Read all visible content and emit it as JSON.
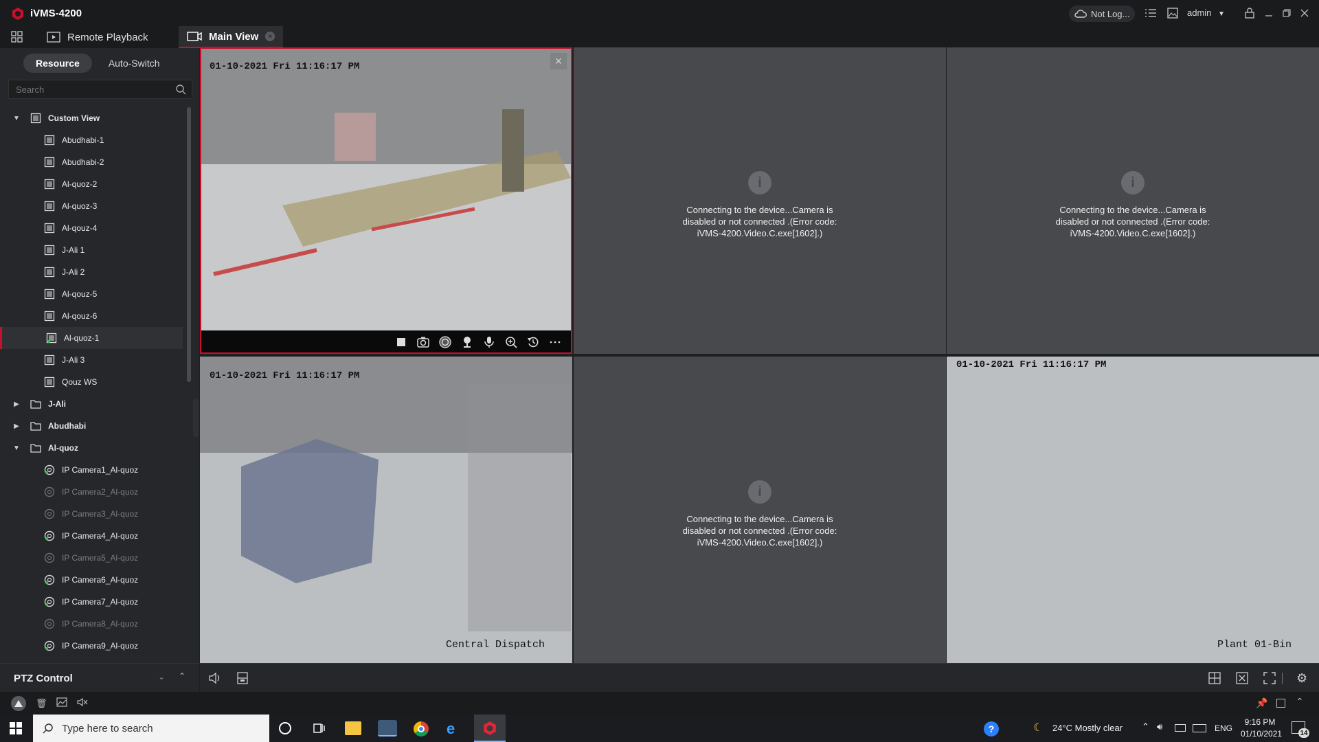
{
  "app": {
    "title": "iVMS-4200"
  },
  "titlebar": {
    "login_status": "Not Log...",
    "user": "admin"
  },
  "tabs": [
    {
      "label": "Remote Playback"
    },
    {
      "label": "Main View"
    }
  ],
  "sidebar": {
    "segments": [
      "Resource",
      "Auto-Switch"
    ],
    "search_placeholder": "Search",
    "tree": [
      {
        "label": "Custom View",
        "level": 0,
        "kind": "view-group",
        "expanded": true,
        "bold": true
      },
      {
        "label": "Abudhabi-1",
        "level": 1,
        "kind": "view"
      },
      {
        "label": "Abudhabi-2",
        "level": 1,
        "kind": "view"
      },
      {
        "label": "Al-quoz-2",
        "level": 1,
        "kind": "view"
      },
      {
        "label": "Al-quoz-3",
        "level": 1,
        "kind": "view"
      },
      {
        "label": "Al-qouz-4",
        "level": 1,
        "kind": "view"
      },
      {
        "label": "J-Ali 1",
        "level": 1,
        "kind": "view"
      },
      {
        "label": "J-Ali 2",
        "level": 1,
        "kind": "view"
      },
      {
        "label": "Al-qouz-5",
        "level": 1,
        "kind": "view"
      },
      {
        "label": "Al-qouz-6",
        "level": 1,
        "kind": "view"
      },
      {
        "label": "Al-quoz-1",
        "level": 1,
        "kind": "view",
        "selected": true
      },
      {
        "label": "J-Ali 3",
        "level": 1,
        "kind": "view"
      },
      {
        "label": "Qouz WS",
        "level": 1,
        "kind": "view"
      },
      {
        "label": "J-Ali",
        "level": 0,
        "kind": "folder",
        "expanded": false,
        "bold": true
      },
      {
        "label": "Abudhabi",
        "level": 0,
        "kind": "folder",
        "expanded": false,
        "bold": true
      },
      {
        "label": "Al-quoz",
        "level": 0,
        "kind": "folder",
        "expanded": true,
        "bold": true
      },
      {
        "label": "IP Camera1_Al-quoz",
        "level": 1,
        "kind": "camera",
        "online": true
      },
      {
        "label": "IP Camera2_Al-quoz",
        "level": 1,
        "kind": "camera",
        "online": false
      },
      {
        "label": "IP Camera3_Al-quoz",
        "level": 1,
        "kind": "camera",
        "online": false
      },
      {
        "label": "IP Camera4_Al-quoz",
        "level": 1,
        "kind": "camera",
        "online": true
      },
      {
        "label": "IP Camera5_Al-quoz",
        "level": 1,
        "kind": "camera",
        "online": false
      },
      {
        "label": "IP Camera6_Al-quoz",
        "level": 1,
        "kind": "camera",
        "online": true
      },
      {
        "label": "IP Camera7_Al-quoz",
        "level": 1,
        "kind": "camera",
        "online": true
      },
      {
        "label": "IP Camera8_Al-quoz",
        "level": 1,
        "kind": "camera",
        "online": false
      },
      {
        "label": "IP Camera9_Al-quoz",
        "level": 1,
        "kind": "camera",
        "online": true
      }
    ]
  },
  "ptz": {
    "title": "PTZ Control"
  },
  "tiles": [
    {
      "type": "video",
      "timestamp": "01-10-2021 Fri 11:16:17 PM",
      "name": "",
      "selected": true
    },
    {
      "type": "error",
      "message": "Connecting to the device...Camera is disabled or not connected .(Error code: iVMS-4200.Video.C.exe[1602].)"
    },
    {
      "type": "error",
      "message": "Connecting to the device...Camera is disabled or not connected .(Error code: iVMS-4200.Video.C.exe[1602].)"
    },
    {
      "type": "video",
      "timestamp": "01-10-2021 Fri 11:16:17 PM",
      "name": "Central Dispatch"
    },
    {
      "type": "error",
      "message": "Connecting to the device...Camera is disabled or not connected .(Error code: iVMS-4200.Video.C.exe[1602].)"
    },
    {
      "type": "video",
      "timestamp": "01-10-2021 Fri 11:16:17 PM",
      "name": "Plant 01-Bin"
    }
  ],
  "taskbar": {
    "search_placeholder": "Type here to search",
    "weather": "24°C  Mostly clear",
    "language": "ENG",
    "time": "9:16 PM",
    "date": "01/10/2021",
    "notification_count": "14"
  },
  "colors": {
    "accent": "#c8102e",
    "panel": "#26272a",
    "tile_empty": "#48494d"
  }
}
